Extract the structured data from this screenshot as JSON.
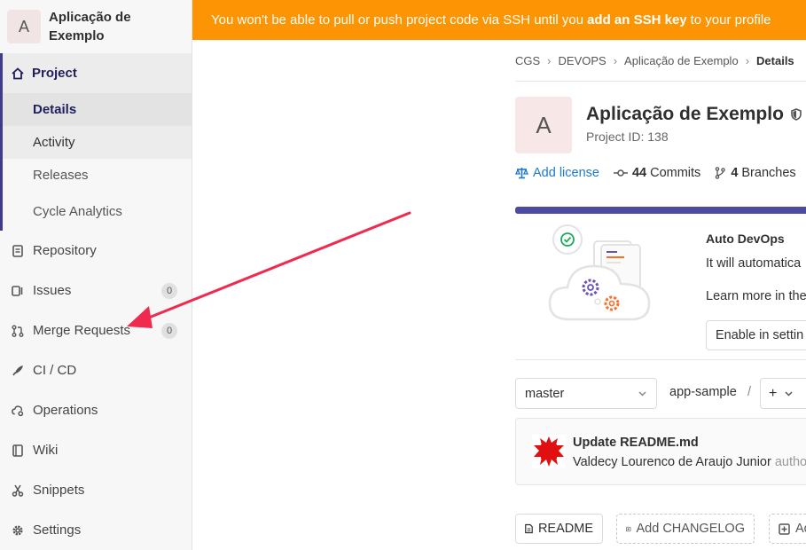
{
  "sidebar": {
    "project_avatar_letter": "A",
    "project_name": "Aplicação de Exemplo",
    "project_section": {
      "label": "Project",
      "items": [
        {
          "label": "Details"
        },
        {
          "label": "Activity"
        },
        {
          "label": "Releases"
        },
        {
          "label": "Cycle Analytics"
        }
      ]
    },
    "items": [
      {
        "label": "Repository",
        "icon": "repository-icon"
      },
      {
        "label": "Issues",
        "icon": "issues-icon",
        "badge": "0"
      },
      {
        "label": "Merge Requests",
        "icon": "merge-request-icon",
        "badge": "0"
      },
      {
        "label": "CI / CD",
        "icon": "rocket-icon"
      },
      {
        "label": "Operations",
        "icon": "cloud-gear-icon"
      },
      {
        "label": "Wiki",
        "icon": "book-icon"
      },
      {
        "label": "Snippets",
        "icon": "scissors-icon"
      },
      {
        "label": "Settings",
        "icon": "gear-icon"
      }
    ]
  },
  "banner": {
    "prefix": "You won't be able to pull or push project code via SSH until you",
    "link": "add an SSH key",
    "suffix": "to your profile",
    "color": "#fc9403"
  },
  "breadcrumb": [
    "CGS",
    "DEVOPS",
    "Aplicação de Exemplo",
    "Details"
  ],
  "project": {
    "avatar_letter": "A",
    "title": "Aplicação de Exemplo",
    "id_text": "Project ID: 138",
    "add_license": "Add license",
    "commits_count": "44",
    "commits_label": "Commits",
    "branches_count": "4",
    "branches_label": "Branches"
  },
  "autodevops": {
    "title": "Auto DevOps",
    "line1": "It will automatica",
    "line2": "Learn more in the",
    "button": "Enable in settin"
  },
  "repo": {
    "branch": "master",
    "path": "app-sample",
    "path_sep": "/",
    "add_symbol": "+"
  },
  "commit": {
    "title": "Update README.md",
    "author": "Valdecy Lourenco de Araujo Junior",
    "authored": "autho"
  },
  "buttons": {
    "readme": "README",
    "changelog": "Add CHANGELOG",
    "next": "Ac"
  },
  "annotation": {
    "arrow_color": "#f0294f"
  }
}
